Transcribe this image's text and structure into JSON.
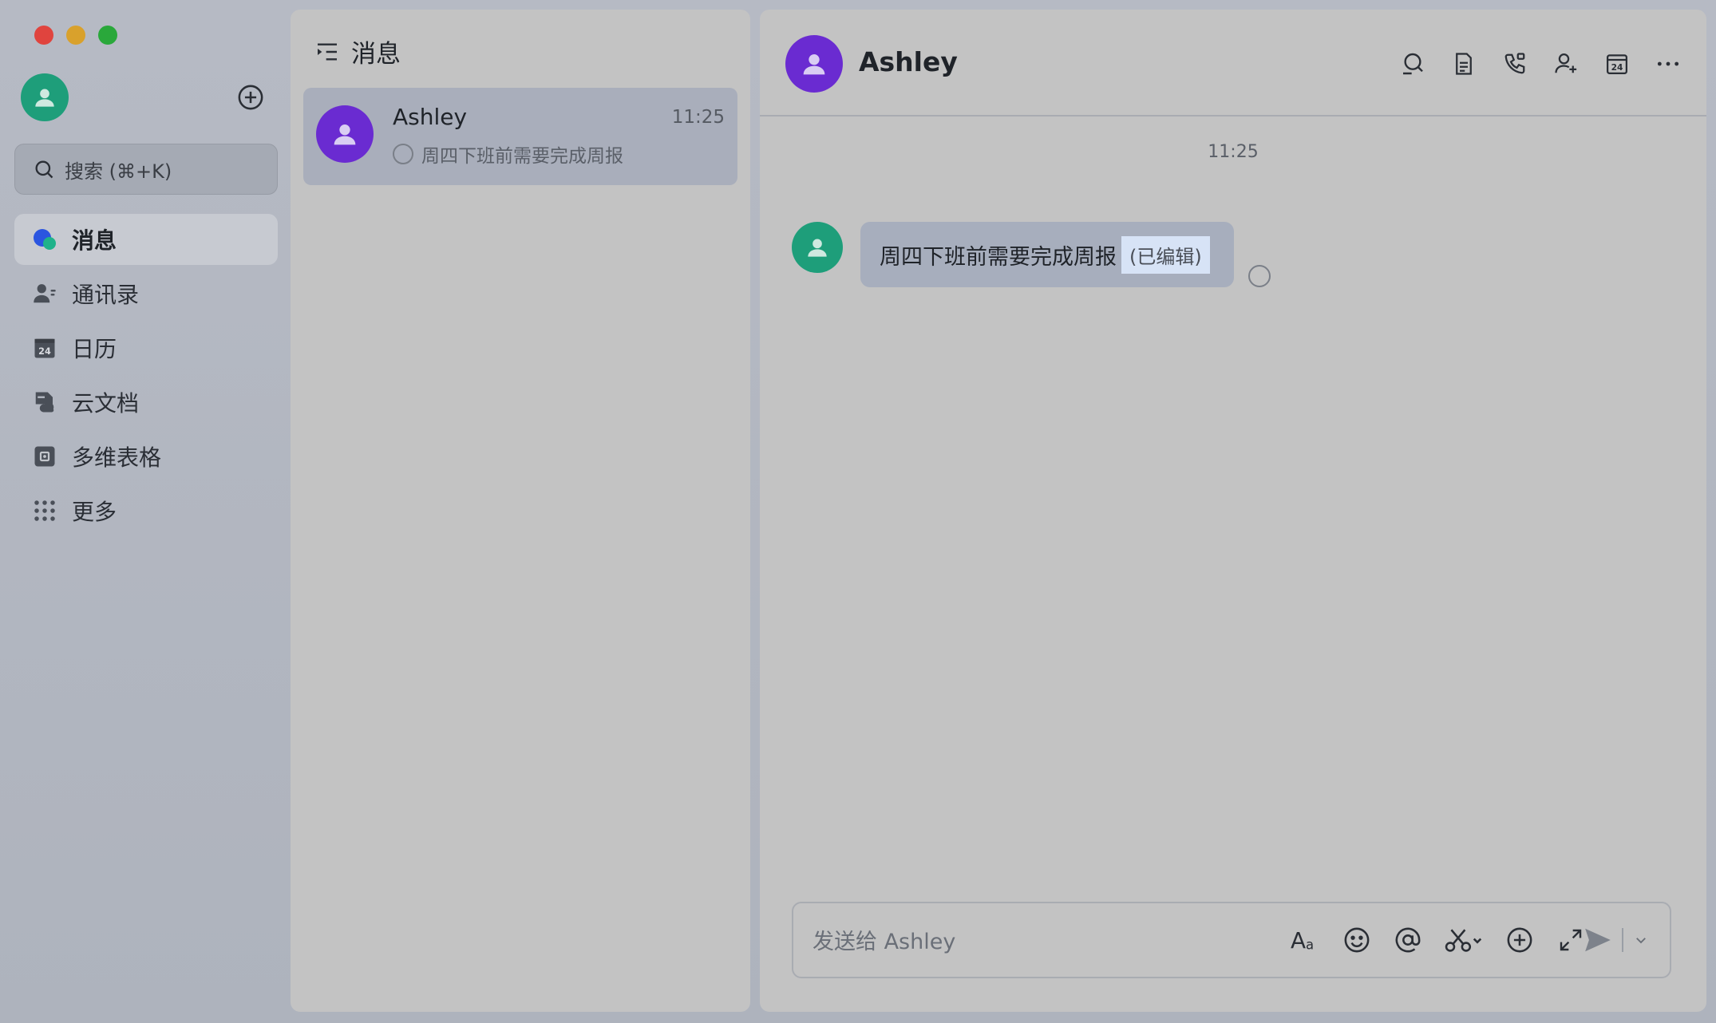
{
  "sidebar": {
    "search_label": "搜索 (⌘+K)",
    "nav": [
      {
        "label": "消息",
        "icon": "message-icon",
        "active": true
      },
      {
        "label": "通讯录",
        "icon": "contacts-icon",
        "active": false
      },
      {
        "label": "日历",
        "icon": "calendar-icon",
        "active": false
      },
      {
        "label": "云文档",
        "icon": "cloud-docs-icon",
        "active": false
      },
      {
        "label": "多维表格",
        "icon": "base-table-icon",
        "active": false
      },
      {
        "label": "更多",
        "icon": "more-apps-icon",
        "active": false
      }
    ]
  },
  "list": {
    "title": "消息",
    "chats": [
      {
        "name": "Ashley",
        "time": "11:25",
        "preview": "周四下班前需要完成周报"
      }
    ]
  },
  "conversation": {
    "title": "Ashley",
    "time_divider": "11:25",
    "message": {
      "text": "周四下班前需要完成周报",
      "edited_tag": "(已编辑)"
    },
    "composer_placeholder": "发送给 Ashley"
  },
  "colors": {
    "avatar_purple": "#6a2bd1",
    "avatar_green": "#1e9e7a",
    "bubble": "#a7aebd",
    "edited_highlight": "#d7e3f6"
  }
}
